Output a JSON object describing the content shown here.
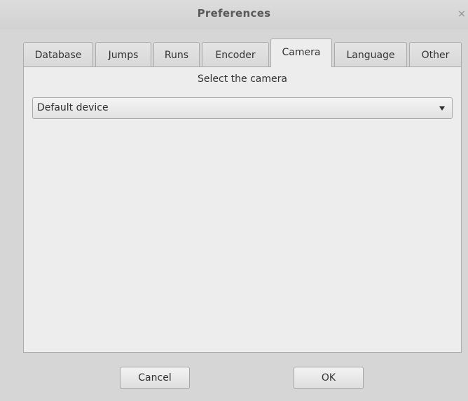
{
  "window": {
    "title": "Preferences",
    "close_glyph": "×"
  },
  "tabs": [
    {
      "label": "Database",
      "active": false
    },
    {
      "label": "Jumps",
      "active": false
    },
    {
      "label": "Runs",
      "active": false
    },
    {
      "label": "Encoder",
      "active": false
    },
    {
      "label": "Camera",
      "active": true
    },
    {
      "label": "Language",
      "active": false
    },
    {
      "label": "Other",
      "active": false
    }
  ],
  "camera_panel": {
    "heading": "Select the camera",
    "camera_select": {
      "value": "Default device"
    }
  },
  "buttons": {
    "cancel_label": "Cancel",
    "ok_label": "OK"
  },
  "icons": {
    "close": "close-icon",
    "dropdown": "chevron-down-icon"
  }
}
